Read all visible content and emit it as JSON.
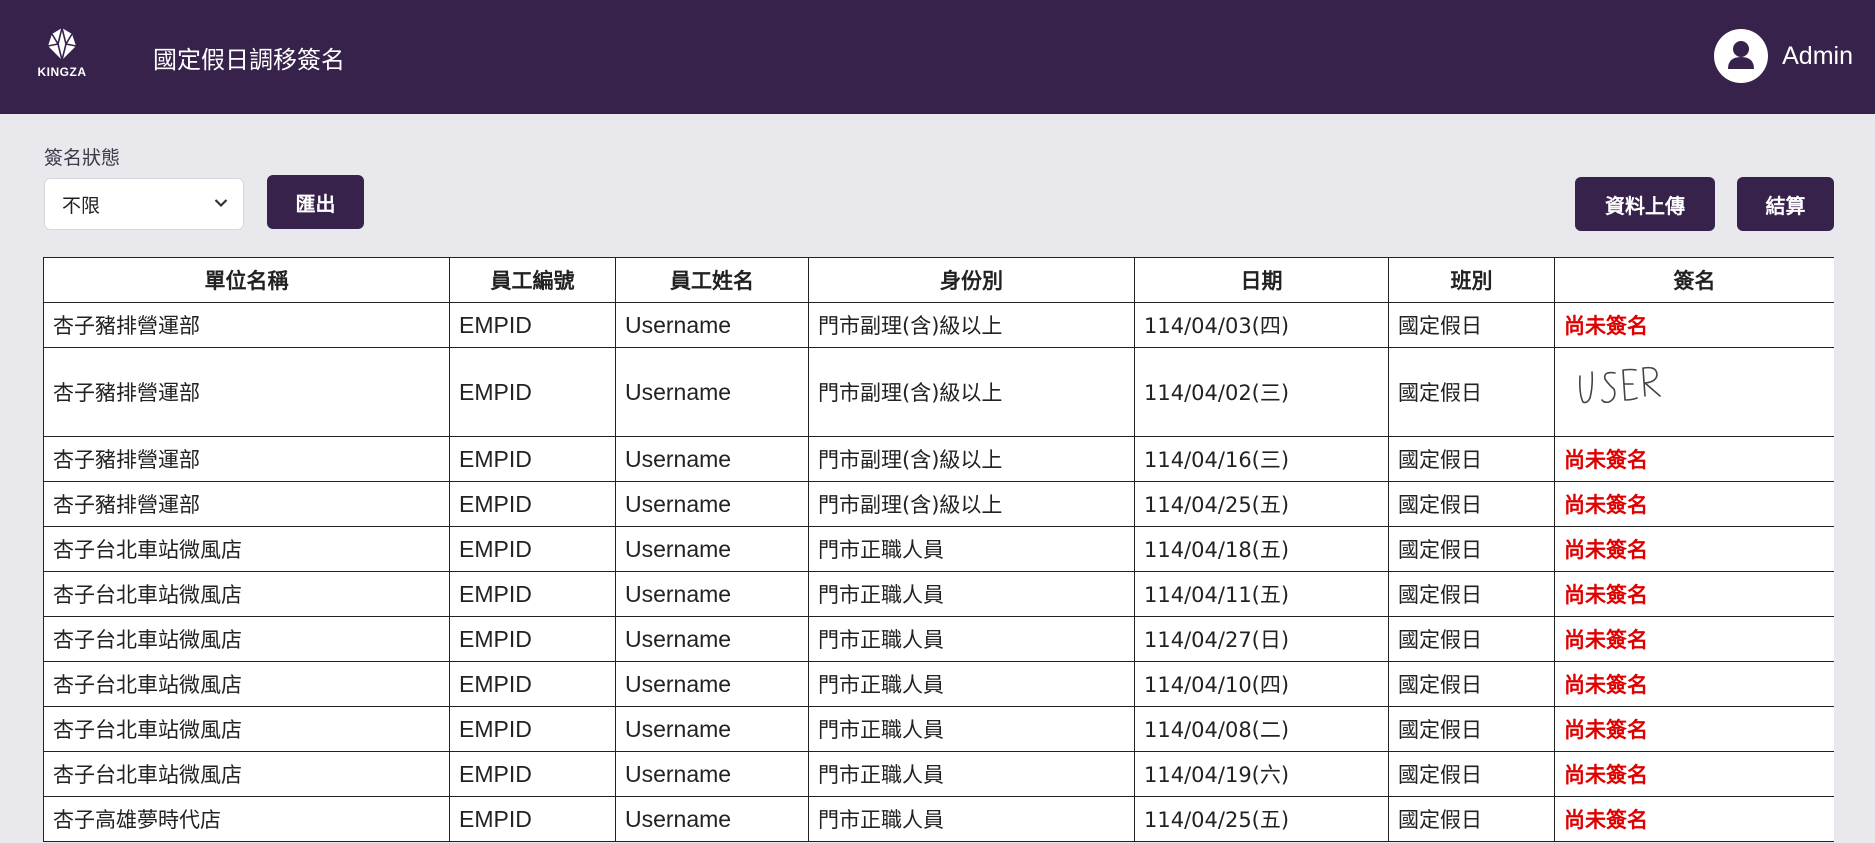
{
  "brand": {
    "logo_text": "KINGZA"
  },
  "header": {
    "title": "國定假日調移簽名",
    "user_name": "Admin"
  },
  "filters": {
    "label": "簽名狀態",
    "selected": "不限"
  },
  "toolbar": {
    "export_label": "匯出",
    "upload_label": "資料上傳",
    "settle_label": "結算"
  },
  "colors": {
    "brand": "#36224a",
    "unsigned": "#e00000",
    "background": "#e9e9ed"
  },
  "table": {
    "columns": [
      "單位名稱",
      "員工編號",
      "員工姓名",
      "身份別",
      "日期",
      "班別",
      "簽名"
    ],
    "rows": [
      {
        "unit": "杏子豬排營運部",
        "emp_id": "EMPID",
        "name": "Username",
        "role": "門市副理(含)級以上",
        "date": "114/04/03(四)",
        "shift": "國定假日",
        "sign": "尚未簽名"
      },
      {
        "unit": "杏子豬排營運部",
        "emp_id": "EMPID",
        "name": "Username",
        "role": "門市副理(含)級以上",
        "date": "114/04/02(三)",
        "shift": "國定假日",
        "sign": "USER"
      },
      {
        "unit": "杏子豬排營運部",
        "emp_id": "EMPID",
        "name": "Username",
        "role": "門市副理(含)級以上",
        "date": "114/04/16(三)",
        "shift": "國定假日",
        "sign": "尚未簽名"
      },
      {
        "unit": "杏子豬排營運部",
        "emp_id": "EMPID",
        "name": "Username",
        "role": "門市副理(含)級以上",
        "date": "114/04/25(五)",
        "shift": "國定假日",
        "sign": "尚未簽名"
      },
      {
        "unit": "杏子台北車站微風店",
        "emp_id": "EMPID",
        "name": "Username",
        "role": "門市正職人員",
        "date": "114/04/18(五)",
        "shift": "國定假日",
        "sign": "尚未簽名"
      },
      {
        "unit": "杏子台北車站微風店",
        "emp_id": "EMPID",
        "name": "Username",
        "role": "門市正職人員",
        "date": "114/04/11(五)",
        "shift": "國定假日",
        "sign": "尚未簽名"
      },
      {
        "unit": "杏子台北車站微風店",
        "emp_id": "EMPID",
        "name": "Username",
        "role": "門市正職人員",
        "date": "114/04/27(日)",
        "shift": "國定假日",
        "sign": "尚未簽名"
      },
      {
        "unit": "杏子台北車站微風店",
        "emp_id": "EMPID",
        "name": "Username",
        "role": "門市正職人員",
        "date": "114/04/10(四)",
        "shift": "國定假日",
        "sign": "尚未簽名"
      },
      {
        "unit": "杏子台北車站微風店",
        "emp_id": "EMPID",
        "name": "Username",
        "role": "門市正職人員",
        "date": "114/04/08(二)",
        "shift": "國定假日",
        "sign": "尚未簽名"
      },
      {
        "unit": "杏子台北車站微風店",
        "emp_id": "EMPID",
        "name": "Username",
        "role": "門市正職人員",
        "date": "114/04/19(六)",
        "shift": "國定假日",
        "sign": "尚未簽名"
      },
      {
        "unit": "杏子高雄夢時代店",
        "emp_id": "EMPID",
        "name": "Username",
        "role": "門市正職人員",
        "date": "114/04/25(五)",
        "shift": "國定假日",
        "sign": "尚未簽名"
      }
    ]
  }
}
